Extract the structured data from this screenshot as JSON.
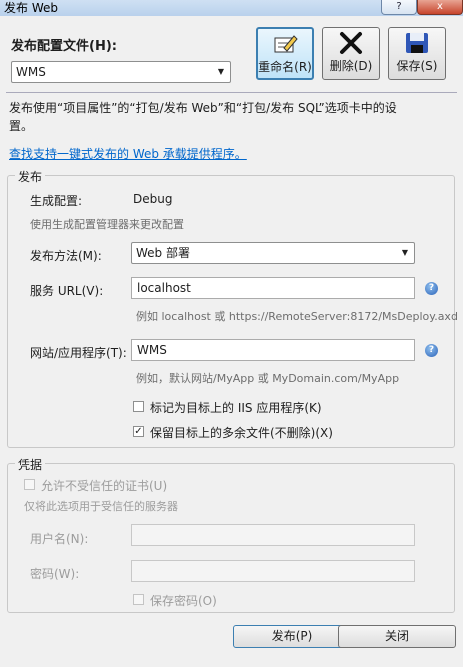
{
  "window": {
    "title": "发布 Web",
    "help_btn": "?",
    "close_btn": "x"
  },
  "profile": {
    "label": "发布配置文件(H):",
    "selected": "WMS"
  },
  "toolbar": {
    "rename_label": "重命名(R)",
    "delete_label": "删除(D)",
    "save_label": "保存(S)"
  },
  "intro": {
    "line1": "发布使用“项目属性”的“打包/发布 Web”和“打包/发布 SQL”选项卡中的设",
    "line2": "置。",
    "link": "查找支持一键式发布的 Web 承载提供程序。"
  },
  "publish": {
    "group_title": "发布",
    "build_config_label": "生成配置:",
    "build_config_value": "Debug",
    "build_config_hint": "使用生成配置管理器来更改配置",
    "method_label": "发布方法(M):",
    "method_value": "Web 部署",
    "service_url_label": "服务 URL(V):",
    "service_url_value": "localhost",
    "service_url_hint": "例如 localhost 或 https://RemoteServer:8172/MsDeploy.axd",
    "site_label": "网站/应用程序(T):",
    "site_value": "WMS",
    "site_hint": "例如，默认网站/MyApp 或 MyDomain.com/MyApp",
    "iis_app_label": "标记为目标上的 IIS 应用程序(K)",
    "iis_app_checked": false,
    "keep_files_label": "保留目标上的多余文件(不删除)(X)",
    "keep_files_checked": true
  },
  "credentials": {
    "group_title": "凭据",
    "untrusted_cert_label": "允许不受信任的证书(U)",
    "untrusted_cert_hint": "仅将此选项用于受信任的服务器",
    "username_label": "用户名(N):",
    "username_value": "",
    "password_label": "密码(W):",
    "password_value": "",
    "save_password_label": "保存密码(O)"
  },
  "footer": {
    "publish_btn": "发布(P)",
    "close_btn": "关闭"
  }
}
